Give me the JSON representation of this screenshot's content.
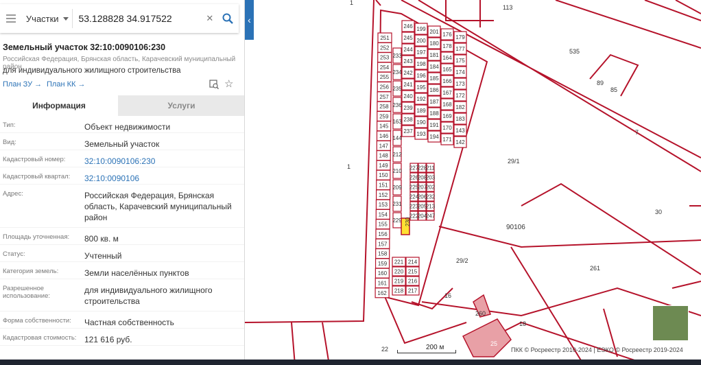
{
  "search": {
    "type_label": "Участки",
    "query": "53.128828 34.917522"
  },
  "parcel": {
    "title": "Земельный участок 32:10:0090106:230",
    "address_line": "Российская Федерация, Брянская область, Карачевский муниципальный район",
    "purpose_line": "для индивидуального жилищного строительства",
    "plan_zu": "План ЗУ →",
    "plan_kk": "План КК →"
  },
  "tabs": {
    "info": "Информация",
    "services": "Услуги"
  },
  "rows": [
    {
      "label": "Тип:",
      "value": "Объект недвижимости"
    },
    {
      "label": "Вид:",
      "value": "Земельный участок"
    },
    {
      "label": "Кадастровый номер:",
      "value": "32:10:0090106:230"
    },
    {
      "label": "Кадастровый квартал:",
      "value": "32:10:0090106"
    },
    {
      "label": "Адрес:",
      "value": "Российская Федерация, Брянская область, Карачевский муниципальный район"
    },
    {
      "label": "Площадь уточненная:",
      "value": "800 кв. м"
    },
    {
      "label": "Статус:",
      "value": "Учтенный"
    },
    {
      "label": "Категория земель:",
      "value": "Земли населённых пунктов"
    },
    {
      "label": "Разрешенное использование:",
      "value": "для индивидуального жилищного строительства"
    },
    {
      "label": "Форма собственности:",
      "value": "Частная собственность"
    },
    {
      "label": "Кадастровая стоимость:",
      "value": "121 616 руб."
    }
  ],
  "map": {
    "accent_color": "#b5122a",
    "highlight_color": "#ffe033",
    "scale_label": "200 м",
    "copyright": "ПКК © Росреестр 2010-2024 | ЕЭКО © Росреестр 2019-2024",
    "labels": {
      "l1": "1",
      "l113": "113",
      "l535": "535",
      "l89": "89",
      "l85": "85",
      "l7": "7",
      "l29_1": "29/1",
      "l30": "30",
      "l90106": "90106",
      "l29_2": "29/2",
      "l261": "261",
      "l16": "16",
      "l18": "18",
      "l260": "260",
      "l25": "25",
      "l22": "22",
      "l1b": "1",
      "highlight": "230"
    },
    "left_column": [
      "251",
      "252",
      "253",
      "254",
      "255",
      "256",
      "257",
      "258",
      "259",
      "145",
      "146",
      "147",
      "148",
      "149",
      "150",
      "151",
      "152",
      "153",
      "154",
      "155",
      "156",
      "157",
      "158",
      "159",
      "160",
      "161",
      "162"
    ],
    "inner_left": [
      "233",
      "234",
      "235",
      "236",
      "163",
      "144",
      "212",
      "210",
      "209",
      "231",
      "229"
    ],
    "block_a": [
      [
        "246",
        "245",
        "244",
        "243",
        "242",
        "241",
        "240",
        "239",
        "238",
        "237"
      ],
      [
        "199",
        "200",
        "197",
        "198",
        "196",
        "195",
        "192",
        "189",
        "190",
        "193"
      ],
      [
        "201",
        "180",
        "181",
        "184",
        "185",
        "186",
        "187",
        "188",
        "191",
        "194"
      ],
      [
        "176",
        "178",
        "164",
        "165",
        "166",
        "167",
        "168",
        "169",
        "170",
        "171"
      ],
      [
        "179",
        "177",
        "175",
        "174",
        "173",
        "172",
        "182",
        "183",
        "143",
        "142"
      ]
    ],
    "block_b": [
      [
        "227",
        "226",
        "225",
        "224",
        "223",
        "222"
      ],
      [
        "228",
        "208",
        "207",
        "206",
        "205",
        "204"
      ],
      [
        "211",
        "203",
        "202",
        "232",
        "213",
        "247"
      ]
    ],
    "block_c": [
      [
        "221",
        "214",
        "220",
        "215",
        "219",
        "216",
        "218",
        "217"
      ]
    ]
  }
}
